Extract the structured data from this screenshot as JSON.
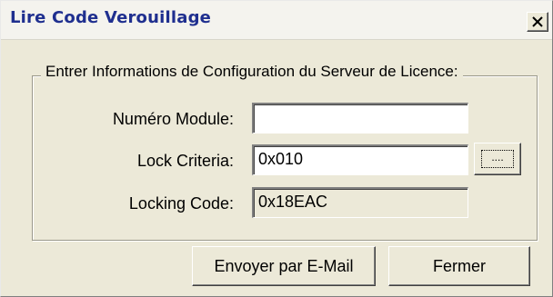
{
  "window": {
    "title": "Lire Code Verouillage",
    "close_symbol": "✕"
  },
  "group": {
    "legend": "Entrer Informations de Configuration du Serveur de Licence:"
  },
  "fields": {
    "module_number": {
      "label": "Numéro Module:",
      "value": ""
    },
    "lock_criteria": {
      "label": "Lock Criteria:",
      "value": "0x010"
    },
    "locking_code": {
      "label": "Locking Code:",
      "value": "0x18EAC"
    }
  },
  "buttons": {
    "browse_label": "....",
    "email_label": "Envoyer par E-Mail",
    "close_label": "Fermer"
  },
  "icons": {
    "close": "close-icon"
  },
  "colors": {
    "title_text": "#1f2f8f",
    "dialog_bg": "#ece9d8",
    "field_bg": "#ffffff"
  }
}
